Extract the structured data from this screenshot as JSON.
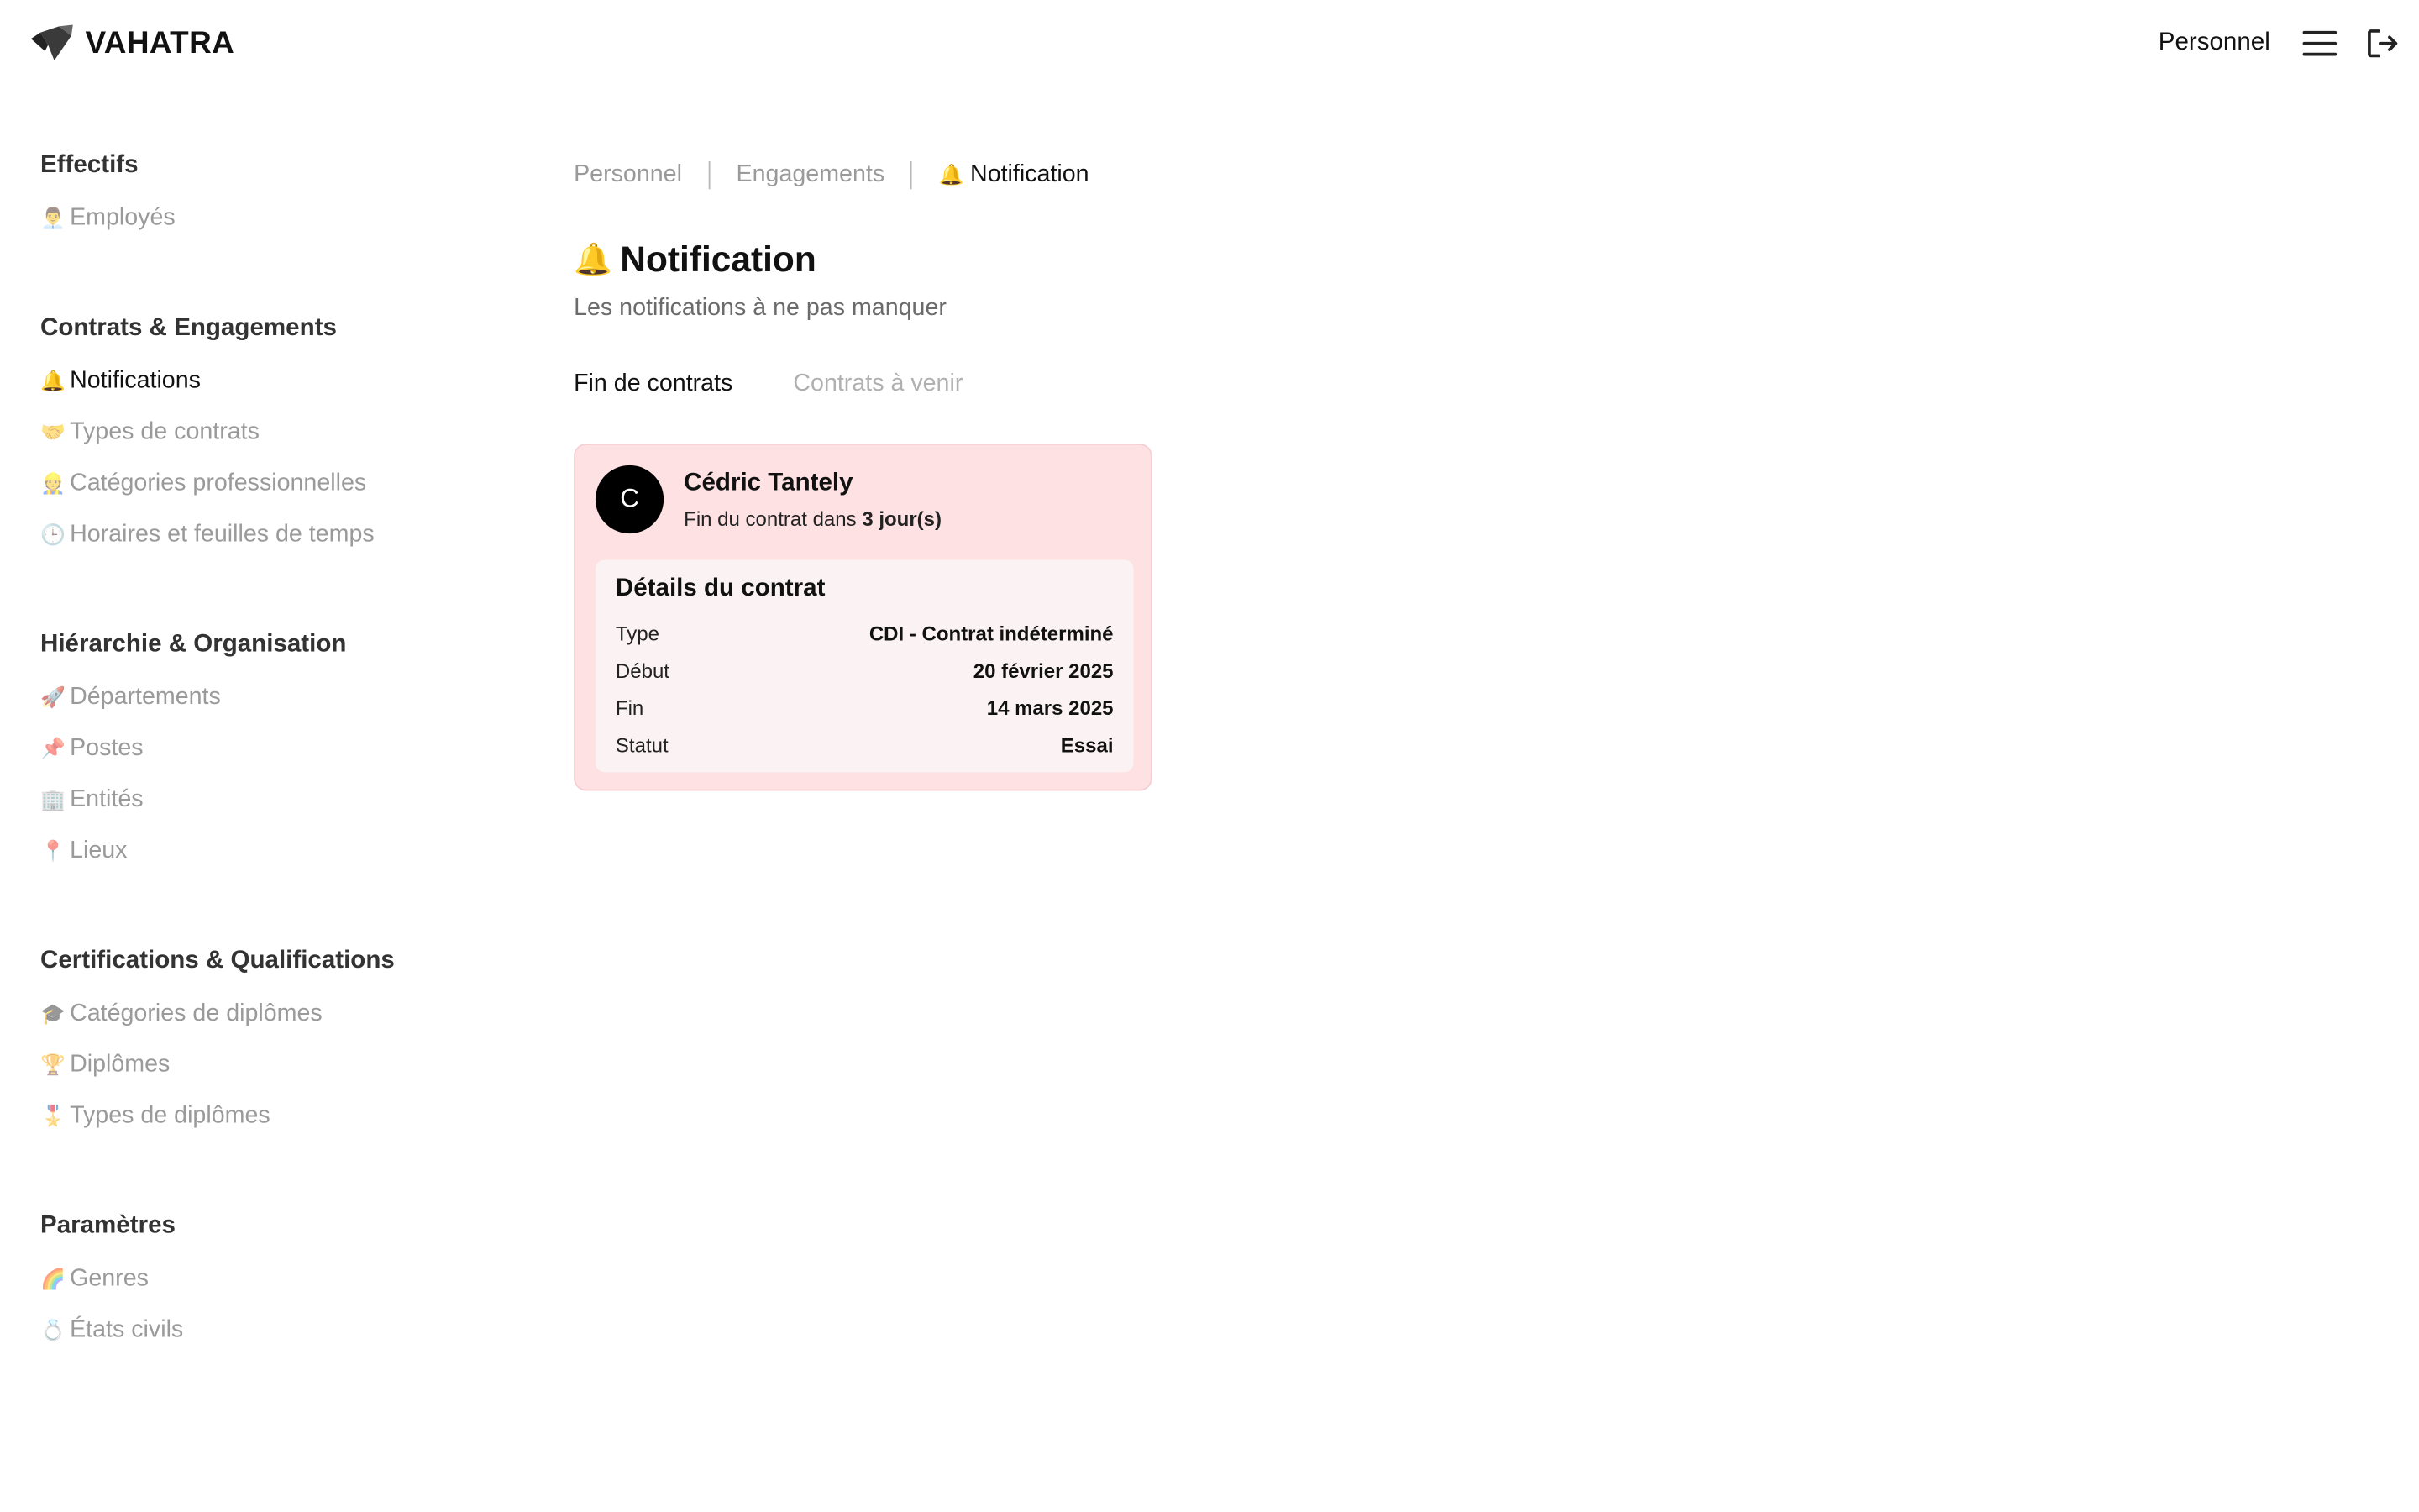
{
  "app": {
    "name": "VAHATRA"
  },
  "header": {
    "section": "Personnel",
    "icons": [
      "hamburger-menu-icon",
      "logout-icon"
    ]
  },
  "sidebar": {
    "groups": [
      {
        "title": "Effectifs",
        "items": [
          {
            "emoji": "👨‍💼",
            "label": "Employés"
          }
        ]
      },
      {
        "title": "Contrats & Engagements",
        "items": [
          {
            "emoji": "🔔",
            "label": "Notifications",
            "active": true
          },
          {
            "emoji": "🤝",
            "label": "Types de contrats"
          },
          {
            "emoji": "👷",
            "label": "Catégories professionnelles"
          },
          {
            "emoji": "🕒",
            "label": "Horaires et feuilles de temps"
          }
        ]
      },
      {
        "title": "Hiérarchie & Organisation",
        "items": [
          {
            "emoji": "🚀",
            "label": "Départements"
          },
          {
            "emoji": "📌",
            "label": "Postes"
          },
          {
            "emoji": "🏢",
            "label": "Entités"
          },
          {
            "emoji": "📍",
            "label": "Lieux"
          }
        ]
      },
      {
        "title": "Certifications & Qualifications",
        "items": [
          {
            "emoji": "🎓",
            "label": "Catégories de diplômes"
          },
          {
            "emoji": "🏆",
            "label": "Diplômes"
          },
          {
            "emoji": "🎖️",
            "label": "Types de diplômes"
          }
        ]
      },
      {
        "title": "Paramètres",
        "items": [
          {
            "emoji": "🌈",
            "label": "Genres"
          },
          {
            "emoji": "💍",
            "label": "États civils"
          }
        ]
      }
    ]
  },
  "breadcrumb": [
    {
      "label": "Personnel"
    },
    {
      "label": "Engagements"
    },
    {
      "emoji": "🔔",
      "label": "Notification"
    }
  ],
  "page": {
    "emoji": "🔔",
    "title": "Notification",
    "subtitle": "Les notifications à ne pas manquer"
  },
  "tabs": [
    {
      "label": "Fin de contrats",
      "active": true
    },
    {
      "label": "Contrats à venir",
      "active": false
    }
  ],
  "notification": {
    "avatar_initial": "C",
    "name": "Cédric Tantely",
    "sub_prefix": "Fin du contrat dans",
    "sub_value": "3 jour(s)",
    "details_title": "Détails du contrat",
    "details": [
      {
        "label": "Type",
        "value": "CDI - Contrat indéterminé"
      },
      {
        "label": "Début",
        "value": "20 février 2025"
      },
      {
        "label": "Fin",
        "value": "14 mars 2025"
      },
      {
        "label": "Statut",
        "value": "Essai"
      }
    ]
  },
  "colors": {
    "card_bg": "#fde1e3",
    "details_bg": "#fbf2f3",
    "muted_text": "#9a9a9a",
    "avatar_bg": "#000000"
  }
}
